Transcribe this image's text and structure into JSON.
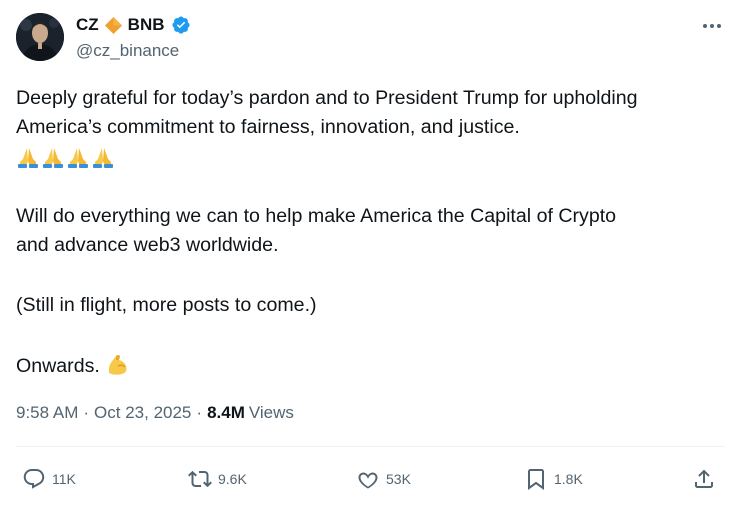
{
  "author": {
    "display_name_first": "CZ",
    "display_name_second": "BNB",
    "handle": "@cz_binance"
  },
  "tweet": {
    "line1": "Deeply grateful for today’s pardon and to President Trump for upholding",
    "line2": "America’s commitment to fairness, innovation, and justice.",
    "emoji_line_icons": [
      "folded-hands-icon",
      "folded-hands-icon",
      "folded-hands-icon",
      "folded-hands-icon"
    ],
    "line3": "Will do everything we can to help make America the Capital of Crypto",
    "line4": "and advance web3 worldwide.",
    "line5": "(Still in flight, more posts to come.)",
    "line6": "Onwards."
  },
  "meta": {
    "time": "9:58 AM",
    "separator": "·",
    "date": "Oct 23, 2025",
    "views_count": "8.4M",
    "views_label": "Views"
  },
  "actions": {
    "replies": "11K",
    "reposts": "9.6K",
    "likes": "53K",
    "bookmarks": "1.8K"
  },
  "colors": {
    "text": "#0f1419",
    "secondary": "#536471",
    "verified": "#1d9bf0",
    "bnb_diamond": "#f0a030",
    "divider": "#eff3f4"
  }
}
